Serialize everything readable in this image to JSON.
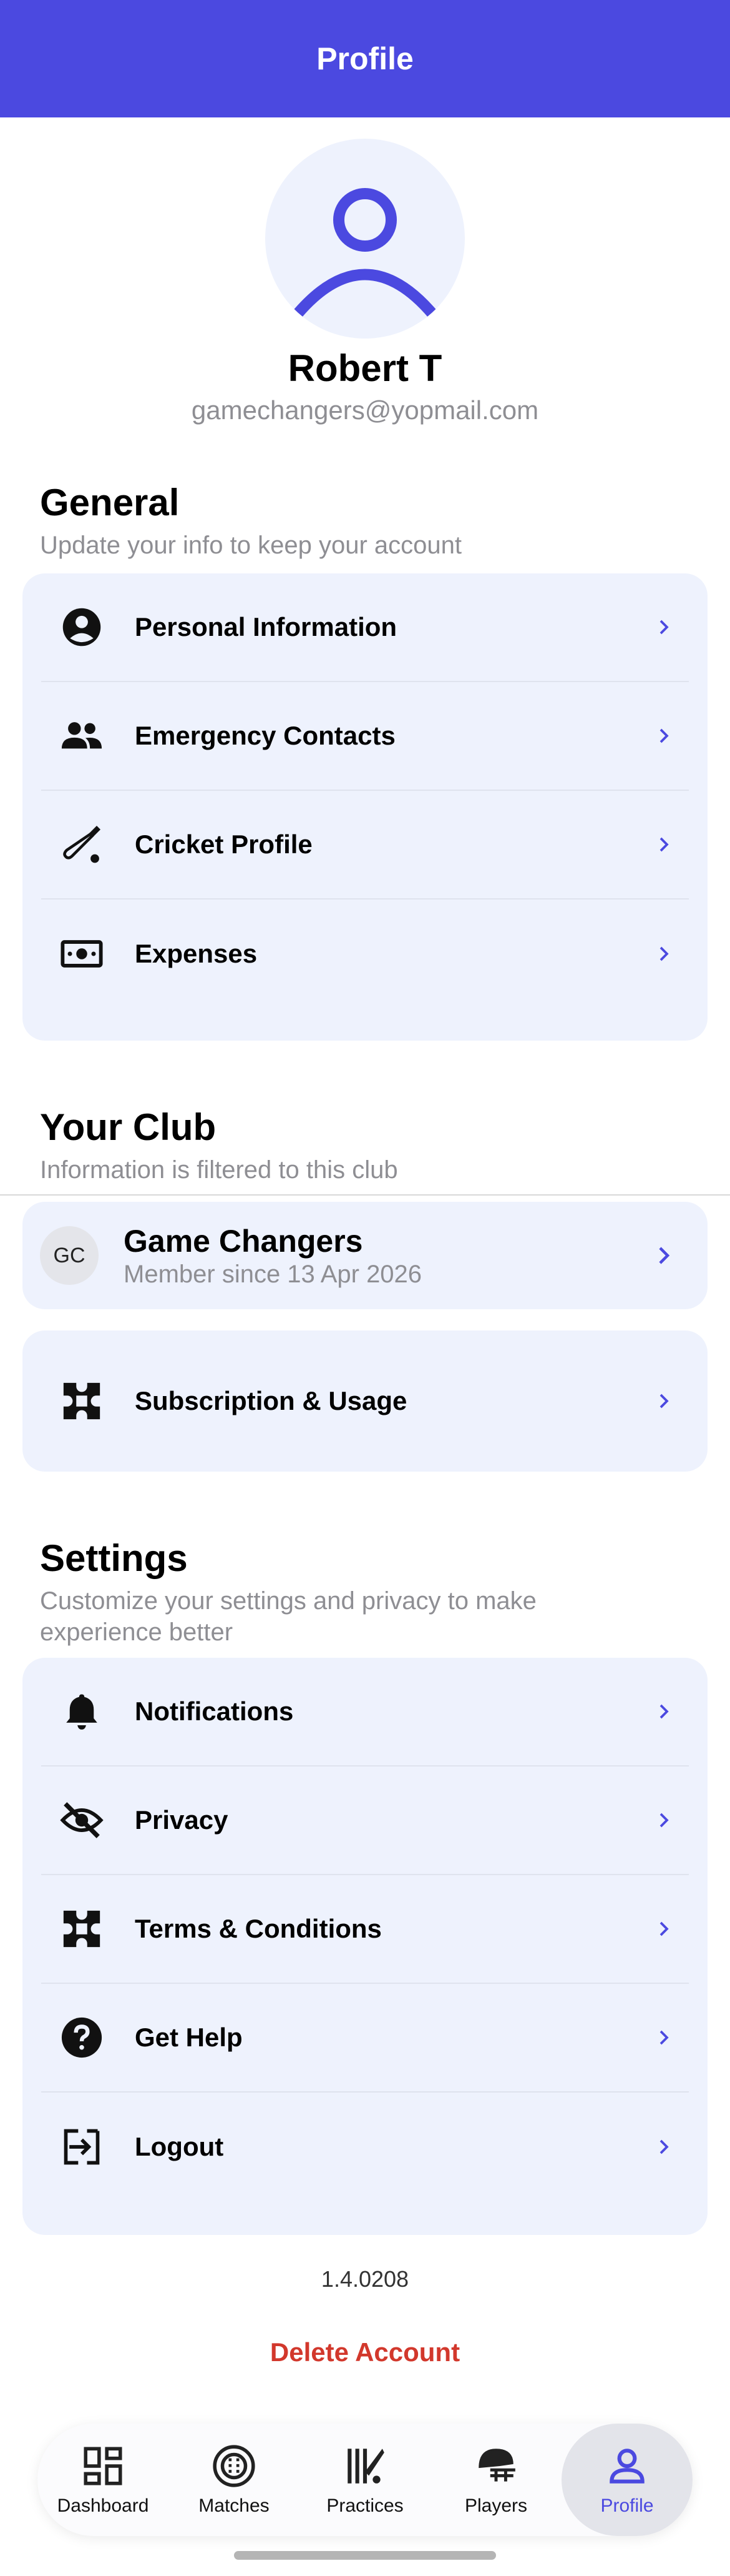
{
  "header": {
    "title": "Profile"
  },
  "profile": {
    "name": "Robert T",
    "email": "gamechangers@yopmail.com"
  },
  "colors": {
    "accent": "#4b49e0",
    "card": "#eef2fd",
    "danger": "#d2382c",
    "muted": "#8e8e93"
  },
  "general": {
    "title": "General",
    "subtitle": "Update your info to keep your account",
    "items": [
      {
        "label": "Personal Information",
        "icon": "account-circle-icon"
      },
      {
        "label": "Emergency Contacts",
        "icon": "people-icon"
      },
      {
        "label": "Cricket Profile",
        "icon": "cricket-bat-icon"
      },
      {
        "label": "Expenses",
        "icon": "cash-icon"
      }
    ]
  },
  "club": {
    "title": "Your Club",
    "subtitle": "Information is filtered to this club",
    "badge": "GC",
    "name": "Game Changers",
    "since": "Member since 13 Apr 2026",
    "subscription_label": "Subscription & Usage",
    "subscription_icon": "puzzle-icon"
  },
  "settings": {
    "title": "Settings",
    "subtitle": "Customize your settings and privacy to make experience better",
    "items": [
      {
        "label": "Notifications",
        "icon": "bell-icon"
      },
      {
        "label": "Privacy",
        "icon": "eye-off-icon"
      },
      {
        "label": "Terms & Conditions",
        "icon": "puzzle-icon"
      },
      {
        "label": "Get Help",
        "icon": "help-circle-icon"
      },
      {
        "label": "Logout",
        "icon": "logout-icon"
      }
    ]
  },
  "footer": {
    "version": "1.4.0208",
    "delete_label": "Delete Account"
  },
  "tabs": [
    {
      "label": "Dashboard",
      "icon": "dashboard-icon"
    },
    {
      "label": "Matches",
      "icon": "cricket-ball-icon"
    },
    {
      "label": "Practices",
      "icon": "practice-icon"
    },
    {
      "label": "Players",
      "icon": "helmet-icon"
    },
    {
      "label": "Profile",
      "icon": "person-icon",
      "active": true
    }
  ]
}
